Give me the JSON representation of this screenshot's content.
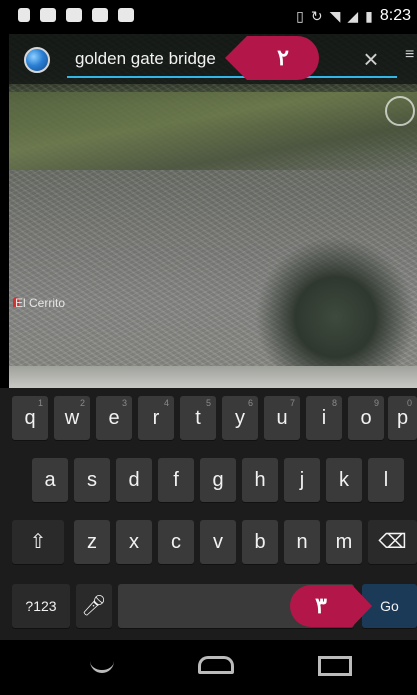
{
  "status_bar": {
    "time": "8:23"
  },
  "search": {
    "query": "golden gate bridge"
  },
  "map": {
    "place_label": "El Cerrito"
  },
  "annotations": {
    "callout_2": "٢",
    "callout_3": "٣"
  },
  "keyboard": {
    "row1": [
      {
        "label": "q",
        "hint": "1"
      },
      {
        "label": "w",
        "hint": "2"
      },
      {
        "label": "e",
        "hint": "3"
      },
      {
        "label": "r",
        "hint": "4"
      },
      {
        "label": "t",
        "hint": "5"
      },
      {
        "label": "y",
        "hint": "6"
      },
      {
        "label": "u",
        "hint": "7"
      },
      {
        "label": "i",
        "hint": "8"
      },
      {
        "label": "o",
        "hint": "9"
      },
      {
        "label": "p",
        "hint": "0"
      }
    ],
    "row2": [
      "a",
      "s",
      "d",
      "f",
      "g",
      "h",
      "j",
      "k",
      "l"
    ],
    "row3": [
      "z",
      "x",
      "c",
      "v",
      "b",
      "n",
      "m"
    ],
    "symbols_label": "?123",
    "action_label": "Go"
  },
  "icons": [
    "earth-icon",
    "close-icon",
    "layers-icon",
    "compass-icon",
    "shift-icon",
    "backspace-icon",
    "mic-icon",
    "back-icon",
    "home-icon",
    "recents-icon"
  ]
}
